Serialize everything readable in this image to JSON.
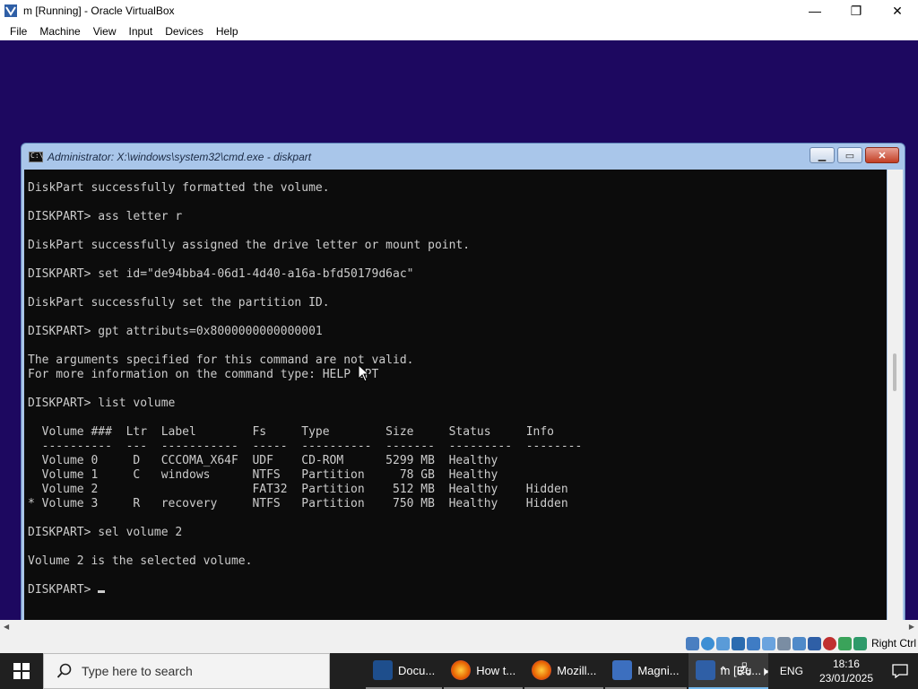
{
  "vbox": {
    "title": "m [Running] - Oracle VirtualBox",
    "menu": [
      "File",
      "Machine",
      "View",
      "Input",
      "Devices",
      "Help"
    ],
    "host_key": "Right Ctrl"
  },
  "cmd": {
    "title": "Administrator: X:\\windows\\system32\\cmd.exe - diskpart",
    "lines": [
      "DiskPart successfully formatted the volume.",
      "",
      "DISKPART> ass letter r",
      "",
      "DiskPart successfully assigned the drive letter or mount point.",
      "",
      "DISKPART> set id=\"de94bba4-06d1-4d40-a16a-bfd50179d6ac\"",
      "",
      "DiskPart successfully set the partition ID.",
      "",
      "DISKPART> gpt attributs=0x8000000000000001",
      "",
      "The arguments specified for this command are not valid.",
      "For more information on the command type: HELP GPT",
      "",
      "DISKPART> list volume",
      "",
      "  Volume ###  Ltr  Label        Fs     Type        Size     Status     Info",
      "  ----------  ---  -----------  -----  ----------  -------  ---------  --------",
      "  Volume 0     D   CCCOMA_X64F  UDF    CD-ROM      5299 MB  Healthy",
      "  Volume 1     C   windows      NTFS   Partition     78 GB  Healthy",
      "  Volume 2                      FAT32  Partition    512 MB  Healthy    Hidden",
      "* Volume 3     R   recovery     NTFS   Partition    750 MB  Healthy    Hidden",
      "",
      "DISKPART> sel volume 2",
      "",
      "Volume 2 is the selected volume.",
      ""
    ],
    "prompt": "DISKPART> "
  },
  "taskbar": {
    "search_placeholder": "Type here to search",
    "items": [
      {
        "label": "Docu...",
        "icon": "document-icon",
        "color": "#1e4e8c"
      },
      {
        "label": "How t...",
        "icon": "firefox-icon",
        "color": "#e66000"
      },
      {
        "label": "Mozill...",
        "icon": "firefox-icon",
        "color": "#e66000"
      },
      {
        "label": "Magni...",
        "icon": "magnifier-icon",
        "color": "#3c6fbf"
      },
      {
        "label": "m [Ru...",
        "icon": "virtualbox-icon",
        "color": "#2f5fa6"
      }
    ],
    "lang": "ENG",
    "time": "18:16",
    "date": "23/01/2025"
  }
}
